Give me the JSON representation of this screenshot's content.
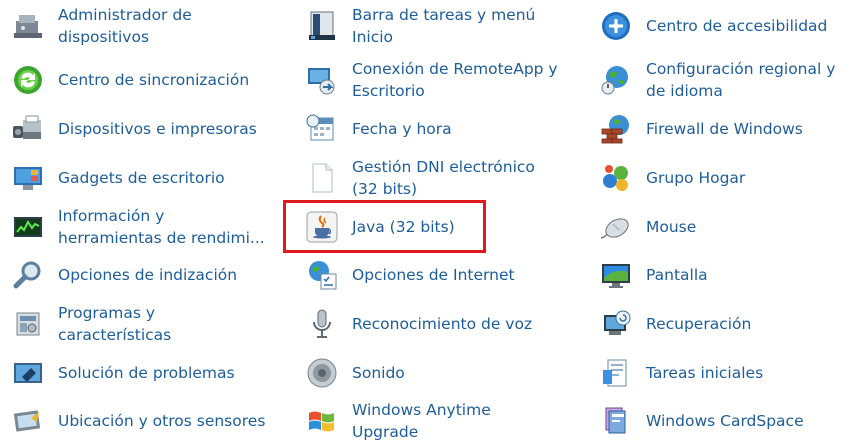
{
  "columns": [
    {
      "items": [
        {
          "label": "Administrador de\ndispositivos",
          "icon": "device-manager-icon"
        },
        {
          "label": "Centro de sincronización",
          "icon": "sync-center-icon"
        },
        {
          "label": "Dispositivos e impresoras",
          "icon": "devices-printers-icon"
        },
        {
          "label": "Gadgets de escritorio",
          "icon": "desktop-gadgets-icon"
        },
        {
          "label": "Información y\nherramientas de rendimi...",
          "icon": "performance-info-icon"
        },
        {
          "label": "Opciones de indización",
          "icon": "indexing-options-icon"
        },
        {
          "label": "Programas y\ncaracterísticas",
          "icon": "programs-features-icon"
        },
        {
          "label": "Solución de problemas",
          "icon": "troubleshooting-icon"
        },
        {
          "label": "Ubicación y otros sensores",
          "icon": "location-sensors-icon"
        }
      ]
    },
    {
      "items": [
        {
          "label": "Barra de tareas y menú\nInicio",
          "icon": "taskbar-start-menu-icon"
        },
        {
          "label": "Conexión de RemoteApp y\nEscritorio",
          "icon": "remoteapp-icon"
        },
        {
          "label": "Fecha y hora",
          "icon": "date-time-icon"
        },
        {
          "label": "Gestión DNI electrónico\n(32 bits)",
          "icon": "dni-blank-document-icon"
        },
        {
          "label": "Java (32 bits)",
          "icon": "java-icon"
        },
        {
          "label": "Opciones de Internet",
          "icon": "internet-options-icon"
        },
        {
          "label": "Reconocimiento de voz",
          "icon": "microphone-icon"
        },
        {
          "label": "Sonido",
          "icon": "speaker-icon"
        },
        {
          "label": "Windows Anytime\nUpgrade",
          "icon": "windows-anytime-upgrade-icon"
        }
      ]
    },
    {
      "items": [
        {
          "label": "Centro de accesibilidad",
          "icon": "accessibility-icon"
        },
        {
          "label": "Configuración regional y\nde idioma",
          "icon": "region-language-icon"
        },
        {
          "label": "Firewall de Windows",
          "icon": "firewall-icon"
        },
        {
          "label": "Grupo Hogar",
          "icon": "homegroup-icon"
        },
        {
          "label": "Mouse",
          "icon": "mouse-icon"
        },
        {
          "label": "Pantalla",
          "icon": "display-icon"
        },
        {
          "label": "Recuperación",
          "icon": "recovery-icon"
        },
        {
          "label": "Tareas iniciales",
          "icon": "getting-started-icon"
        },
        {
          "label": "Windows CardSpace",
          "icon": "cardspace-icon"
        }
      ]
    }
  ],
  "colors": {
    "link": "#1e5d9a",
    "highlight_border": "#e01a1a"
  }
}
